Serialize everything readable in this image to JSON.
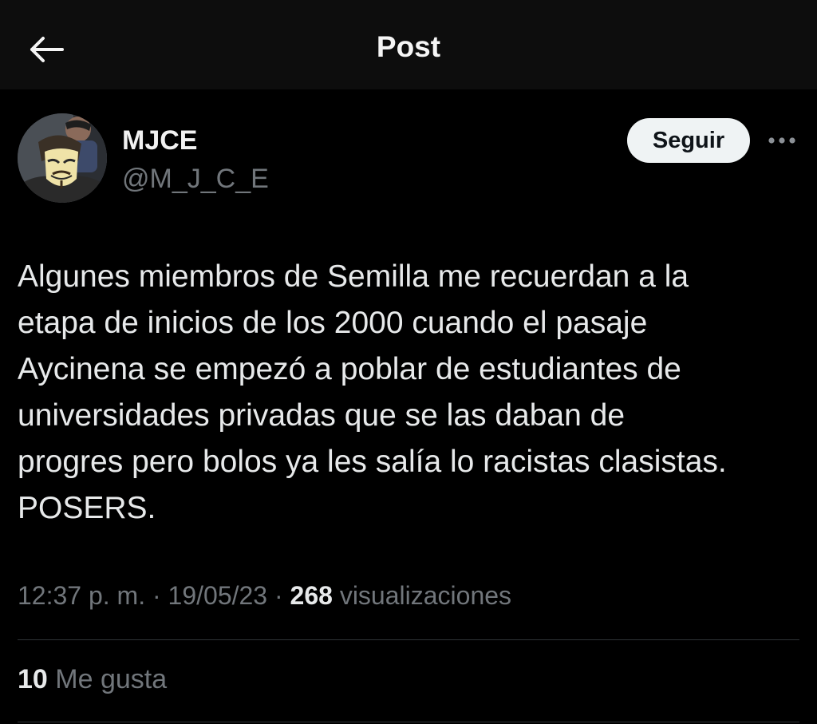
{
  "header": {
    "title": "Post",
    "back_icon": "arrow-left-icon"
  },
  "author": {
    "name": "MJCE",
    "handle": "@M_J_C_E",
    "avatar_icon": "avatar-masked-person"
  },
  "actions": {
    "follow_label": "Seguir",
    "more_icon": "more-horizontal-icon"
  },
  "post": {
    "text": "Algunes miembros de Semilla me recuerdan a la\netapa de inicios de los 2000 cuando el pasaje\nAycinena se empezó a poblar de estudiantes de\nuniversidades privadas que se las daban de\nprogres pero bolos ya les salía lo racistas clasistas.\nPOSERS."
  },
  "meta": {
    "time": "12:37 p. m.",
    "separator": " · ",
    "date": "19/05/23",
    "views_count": "268",
    "views_label": "visualizaciones"
  },
  "engagement": {
    "likes_count": "10",
    "likes_label": "Me gusta"
  },
  "colors": {
    "background": "#000000",
    "header_background": "#0d0d0d",
    "primary_text": "#e7e9ea",
    "secondary_text": "#71767b",
    "follow_button_bg": "#eff3f4",
    "divider": "#2f3336"
  }
}
